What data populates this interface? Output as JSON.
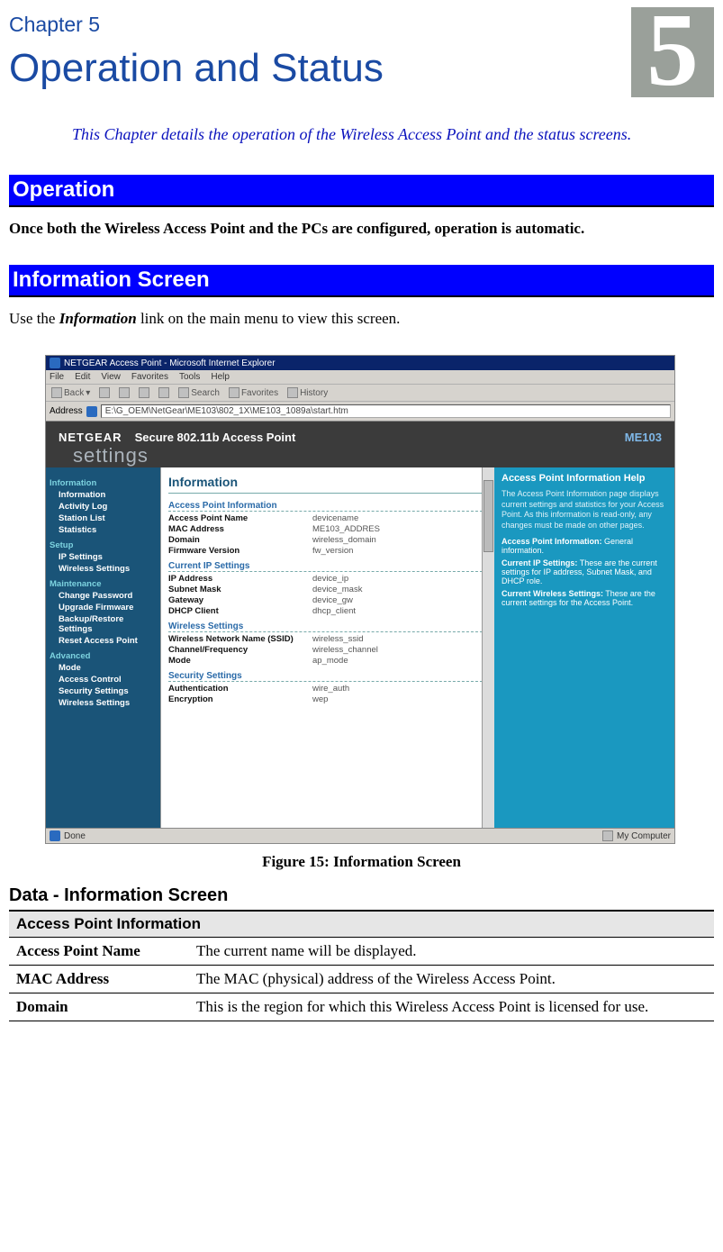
{
  "chapter": {
    "label": "Chapter 5",
    "number": "5",
    "title": "Operation and Status",
    "intro": "This Chapter details the operation of the Wireless Access Point and the status screens."
  },
  "sections": {
    "operation": {
      "heading": "Operation",
      "body": "Once both the Wireless Access Point and the PCs are configured, operation is automatic."
    },
    "info_screen": {
      "heading": "Information Screen",
      "body_pre": "Use the ",
      "body_link": "Information",
      "body_post": " link on the main menu to view this screen.",
      "figure_caption": "Figure 15: Information Screen"
    }
  },
  "screenshot": {
    "window_title": "NETGEAR Access Point - Microsoft Internet Explorer",
    "menus": [
      "File",
      "Edit",
      "View",
      "Favorites",
      "Tools",
      "Help"
    ],
    "toolbar": {
      "back": "Back",
      "search": "Search",
      "favorites": "Favorites",
      "history": "History"
    },
    "address_label": "Address",
    "address_value": "E:\\G_OEM\\NetGear\\ME103\\802_1X\\ME103_1089a\\start.htm",
    "banner": {
      "brand": "NETGEAR",
      "title": "Secure 802.11b Access Point",
      "model": "ME103",
      "settings": "settings"
    },
    "nav": {
      "groups": [
        {
          "label": "Information",
          "items": [
            "Information",
            "Activity Log",
            "Station List",
            "Statistics"
          ]
        },
        {
          "label": "Setup",
          "items": [
            "IP Settings",
            "Wireless Settings"
          ]
        },
        {
          "label": "Maintenance",
          "items": [
            "Change Password",
            "Upgrade Firmware",
            "Backup/Restore Settings",
            "Reset Access Point"
          ]
        },
        {
          "label": "Advanced",
          "items": [
            "Mode",
            "Access Control",
            "Security Settings",
            "Wireless Settings"
          ]
        }
      ]
    },
    "panel": {
      "title": "Information",
      "groups": [
        {
          "label": "Access Point Information",
          "rows": [
            {
              "k": "Access Point Name",
              "v": "devicename"
            },
            {
              "k": "MAC Address",
              "v": "ME103_ADDRES"
            },
            {
              "k": "Domain",
              "v": "wireless_domain"
            },
            {
              "k": "Firmware Version",
              "v": "fw_version"
            }
          ]
        },
        {
          "label": "Current IP Settings",
          "rows": [
            {
              "k": "IP Address",
              "v": "device_ip"
            },
            {
              "k": "Subnet Mask",
              "v": "device_mask"
            },
            {
              "k": "Gateway",
              "v": "device_gw"
            },
            {
              "k": "DHCP Client",
              "v": "dhcp_client"
            }
          ]
        },
        {
          "label": "Wireless Settings",
          "rows": [
            {
              "k": "Wireless Network Name (SSID)",
              "v": "wireless_ssid"
            },
            {
              "k": "Channel/Frequency",
              "v": "wireless_channel"
            },
            {
              "k": "Mode",
              "v": "ap_mode"
            }
          ]
        },
        {
          "label": "Security Settings",
          "rows": [
            {
              "k": "Authentication",
              "v": "wire_auth"
            },
            {
              "k": "Encryption",
              "v": "wep"
            }
          ]
        }
      ]
    },
    "help": {
      "title": "Access Point Information Help",
      "intro": "The Access Point Information page displays current settings and statistics for your Access Point. As this information is read-only, any changes must be made on other pages.",
      "items": [
        {
          "k": "Access Point Information:",
          "v": " General information."
        },
        {
          "k": "Current IP Settings:",
          "v": " These are the current settings for IP address, Subnet Mask, and DHCP role."
        },
        {
          "k": "Current Wireless Settings:",
          "v": " These are the current settings for the Access Point."
        }
      ]
    },
    "status": {
      "done": "Done",
      "zone": "My Computer"
    }
  },
  "data_table": {
    "heading": "Data - Information Screen",
    "title": "Access Point Information",
    "rows": [
      {
        "k": "Access Point Name",
        "v": "The current name will be displayed."
      },
      {
        "k": "MAC Address",
        "v": "The MAC (physical) address of the Wireless Access Point."
      },
      {
        "k": "Domain",
        "v": "This is the region for which this Wireless Access Point is licensed for use."
      }
    ]
  }
}
